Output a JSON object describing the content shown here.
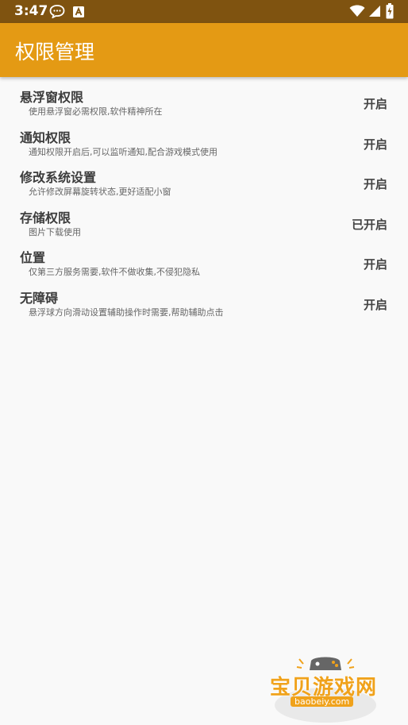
{
  "status_bar": {
    "time": "3:47",
    "icons": [
      "message-icon",
      "a-icon",
      "wifi-icon",
      "signal-icon",
      "battery-icon"
    ]
  },
  "app_bar": {
    "title": "权限管理"
  },
  "permissions": [
    {
      "title": "悬浮窗权限",
      "desc": "使用悬浮窗必需权限,软件精神所在",
      "status": "开启"
    },
    {
      "title": "通知权限",
      "desc": "通知权限开启后,可以监听通知,配合游戏模式使用",
      "status": "开启"
    },
    {
      "title": "修改系统设置",
      "desc": "允许修改屏幕旋转状态,更好适配小窗",
      "status": "开启"
    },
    {
      "title": "存储权限",
      "desc": "图片下载使用",
      "status": "已开启"
    },
    {
      "title": "位置",
      "desc": "仅第三方服务需要,软件不做收集,不侵犯隐私",
      "status": "开启"
    },
    {
      "title": "无障碍",
      "desc": "悬浮球方向滑动设置辅助操作时需要,帮助辅助点击",
      "status": "开启"
    }
  ],
  "watermark": {
    "text": "宝贝游戏网",
    "url": "baobeiy.com"
  },
  "colors": {
    "status_bar": "#7f5310",
    "app_bar": "#e49a14",
    "background": "#f9f9f9",
    "watermark": "#f0a21b"
  }
}
